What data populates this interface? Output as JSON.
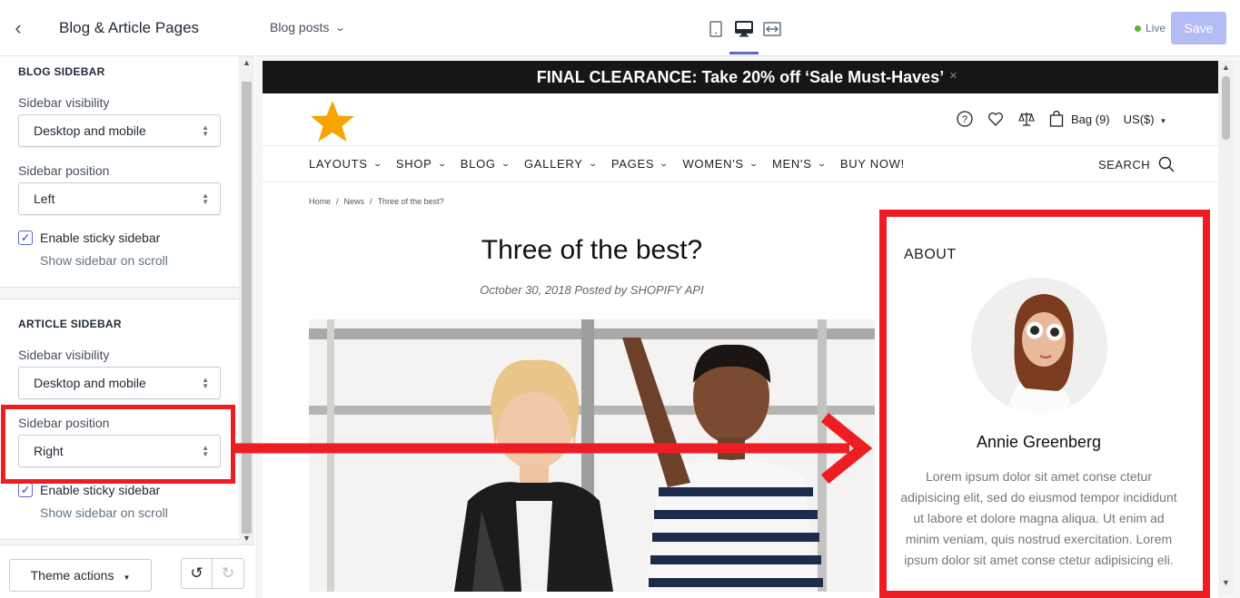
{
  "editor": {
    "title": "Blog & Article Pages",
    "blog_sidebar": {
      "heading": "BLOG SIDEBAR",
      "visibility_label": "Sidebar visibility",
      "visibility_value": "Desktop and mobile",
      "position_label": "Sidebar position",
      "position_value": "Left",
      "sticky_label": "Enable sticky sidebar",
      "sticky_checked": true,
      "sticky_help": "Show sidebar on scroll"
    },
    "article_sidebar": {
      "heading": "ARTICLE SIDEBAR",
      "visibility_label": "Sidebar visibility",
      "visibility_value": "Desktop and mobile",
      "position_label": "Sidebar position",
      "position_value": "Right",
      "sticky_label": "Enable sticky sidebar",
      "sticky_checked": true,
      "sticky_help": "Show sidebar on scroll"
    },
    "footer": {
      "theme_actions": "Theme actions"
    }
  },
  "topbar": {
    "page_select": "Blog posts",
    "status": "Live",
    "save_label": "Save",
    "status_color": "#50b83c",
    "active_device": "desktop"
  },
  "store": {
    "announcement": "FINAL CLEARANCE: Take 20% off ‘Sale Must-Haves’",
    "announcement_close": "×",
    "bag": "Bag (9)",
    "currency": "US($)",
    "nav": [
      "LAYOUTS",
      "SHOP",
      "BLOG",
      "GALLERY",
      "PAGES",
      "WOMEN'S",
      "MEN'S",
      "BUY NOW!"
    ],
    "search": "SEARCH",
    "breadcrumbs": [
      "Home",
      "News",
      "Three of the best?"
    ],
    "post_title": "Three of the best?",
    "post_meta": "October 30, 2018 Posted by SHOPIFY API",
    "about": {
      "heading": "ABOUT",
      "name": "Annie Greenberg",
      "text": "Lorem ipsum dolor sit amet conse ctetur adipisicing elit, sed do eiusmod tempor incididunt ut labore et dolore magna aliqua. Ut enim ad minim veniam, quis nostrud exercitation. Lorem ipsum dolor sit amet conse ctetur adipisicing eli."
    }
  },
  "colors": {
    "accent": "#5c6ac4",
    "highlight": "#ee1d23",
    "announcement_bg": "#161616"
  }
}
